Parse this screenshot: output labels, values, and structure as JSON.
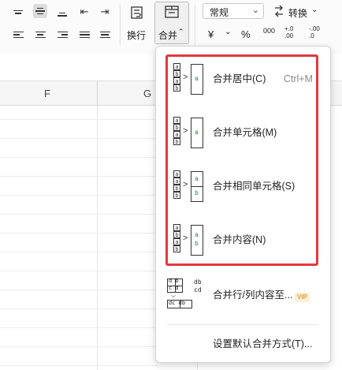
{
  "ribbon": {
    "number_format": "常规",
    "convert_label": "转换",
    "wrap_label": "换行",
    "merge_label": "合并",
    "currency_symbol": "¥",
    "percent_symbol": "%",
    "thousands_symbol": "000",
    "decimal_increase": "+.0\n.00",
    "decimal_decrease": "-.00\n.0"
  },
  "sheet": {
    "column_f": "F",
    "column_g": "G"
  },
  "merge_menu": {
    "items": [
      {
        "label": "合并居中(C)",
        "shortcut": "Ctrl+M"
      },
      {
        "label": "合并单元格(M)"
      },
      {
        "label": "合并相同单元格(S)"
      },
      {
        "label": "合并内容(N)"
      },
      {
        "label": "合并行/列内容至...",
        "badge": "VIP"
      },
      {
        "label": "设置默认合并方式(T)..."
      }
    ],
    "highlight_color": "#e0393e"
  }
}
